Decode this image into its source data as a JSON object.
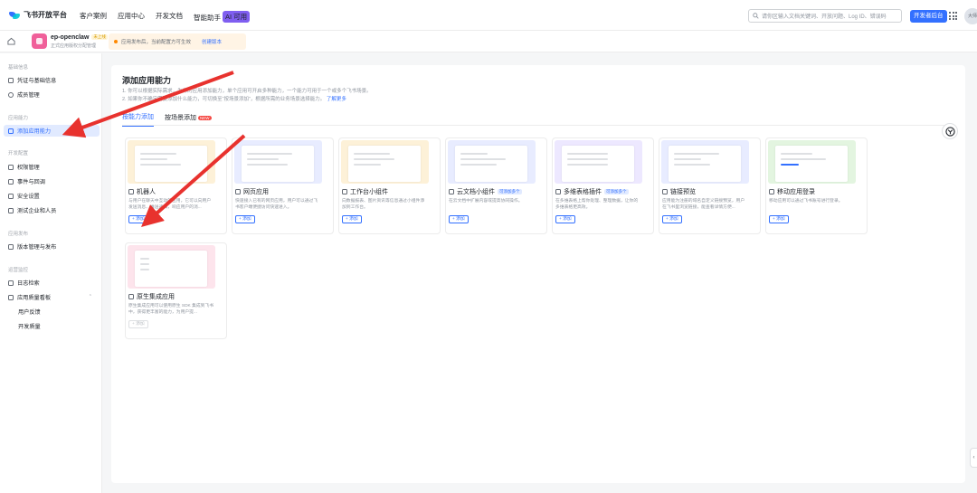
{
  "topbar": {
    "logo_text": "飞书开放平台",
    "nav": [
      "客户案例",
      "应用中心",
      "开发文档",
      "智能助手"
    ],
    "assistant_badge": "AI 可用",
    "search_placeholder": "请你区输入文档关键词、开放问题、Log ID、错误码",
    "dev_button": "开发者后台",
    "avatar_text": "大师"
  },
  "appbar": {
    "app_name": "ep-openclaw",
    "app_status": "未上线",
    "app_subtitle": "正式应用版权分配管理",
    "notice_text": "应用发布后，当前配置方可生效",
    "notice_link": "创建版本"
  },
  "sidebar": {
    "groups": [
      "基础信息",
      "应用能力",
      "开发配置",
      "应用发布",
      "运营监控"
    ],
    "items": [
      {
        "label": "凭证与基础信息",
        "active": false
      },
      {
        "label": "成员管理",
        "active": false
      },
      {
        "label": "添加应用能力",
        "active": true
      },
      {
        "label": "权限管理",
        "active": false
      },
      {
        "label": "事件与回调",
        "active": false
      },
      {
        "label": "安全设置",
        "active": false
      },
      {
        "label": "测试企业和人员",
        "active": false
      },
      {
        "label": "版本管理与发布",
        "active": false
      },
      {
        "label": "日志检索",
        "active": false
      },
      {
        "label": "应用质量看板",
        "active": false
      },
      {
        "label": "用户反馈",
        "active": false
      },
      {
        "label": "开发质量",
        "active": false
      }
    ]
  },
  "main": {
    "title": "添加应用能力",
    "tips": [
      "1. 你可以根据实际需求，为你的应用添加能力，单个应用可开启多种能力，一个能力可用于一个或多个飞书场景。",
      "2. 如果你不确定需要添加什么能力，可切换至“按场景添加”，根据所需的业务场景选择能力。"
    ],
    "tips_link": "了解更多",
    "tabs": [
      {
        "label": "按能力添加",
        "active": true
      },
      {
        "label": "按场景添加",
        "active": false,
        "badge": "NEW"
      }
    ],
    "add_label": "+ 添加",
    "cards": [
      {
        "title": "机器人",
        "tag": "",
        "desc": "与用户在聊天中互动的应用，它可以向用户发送消息、推送通知，响应用户的消...",
        "color": "#fdf1d8"
      },
      {
        "title": "网页应用",
        "tag": "",
        "desc": "快速接入已有的网页应用，用户可以通过飞书客户端便捷访问快速进入。",
        "color": "#e8ecff"
      },
      {
        "title": "工作台小组件",
        "tag": "",
        "desc": "向数据报表、图片资讯等信息通过小组件添加到工作台。",
        "color": "#fdf1d8"
      },
      {
        "title": "云文档小组件",
        "tag": "可添加多个",
        "desc": "在云文档中扩展内容或提高协同操作。",
        "color": "#e8ecff"
      },
      {
        "title": "多维表格插件",
        "tag": "可添加多个",
        "desc": "在多维表格上帮你处理、整理数据，让你的多维表格更高效。",
        "color": "#ede8ff"
      },
      {
        "title": "链接预览",
        "tag": "",
        "desc": "应用能为注册的域名自定义链接预览，用户在飞书里浏览链接，能查看详情方便...",
        "color": "#e8ecff"
      },
      {
        "title": "移动应用登录",
        "tag": "",
        "desc": "移动应用可以通过飞书账号进行登录。",
        "color": "#e3f5e0"
      },
      {
        "title": "原生集成应用",
        "tag": "",
        "desc": "原生集成应用可以使用原生 SDK 集成到飞书中，获得更丰富的能力，为用户提...",
        "color": "#fde4ec"
      }
    ]
  }
}
